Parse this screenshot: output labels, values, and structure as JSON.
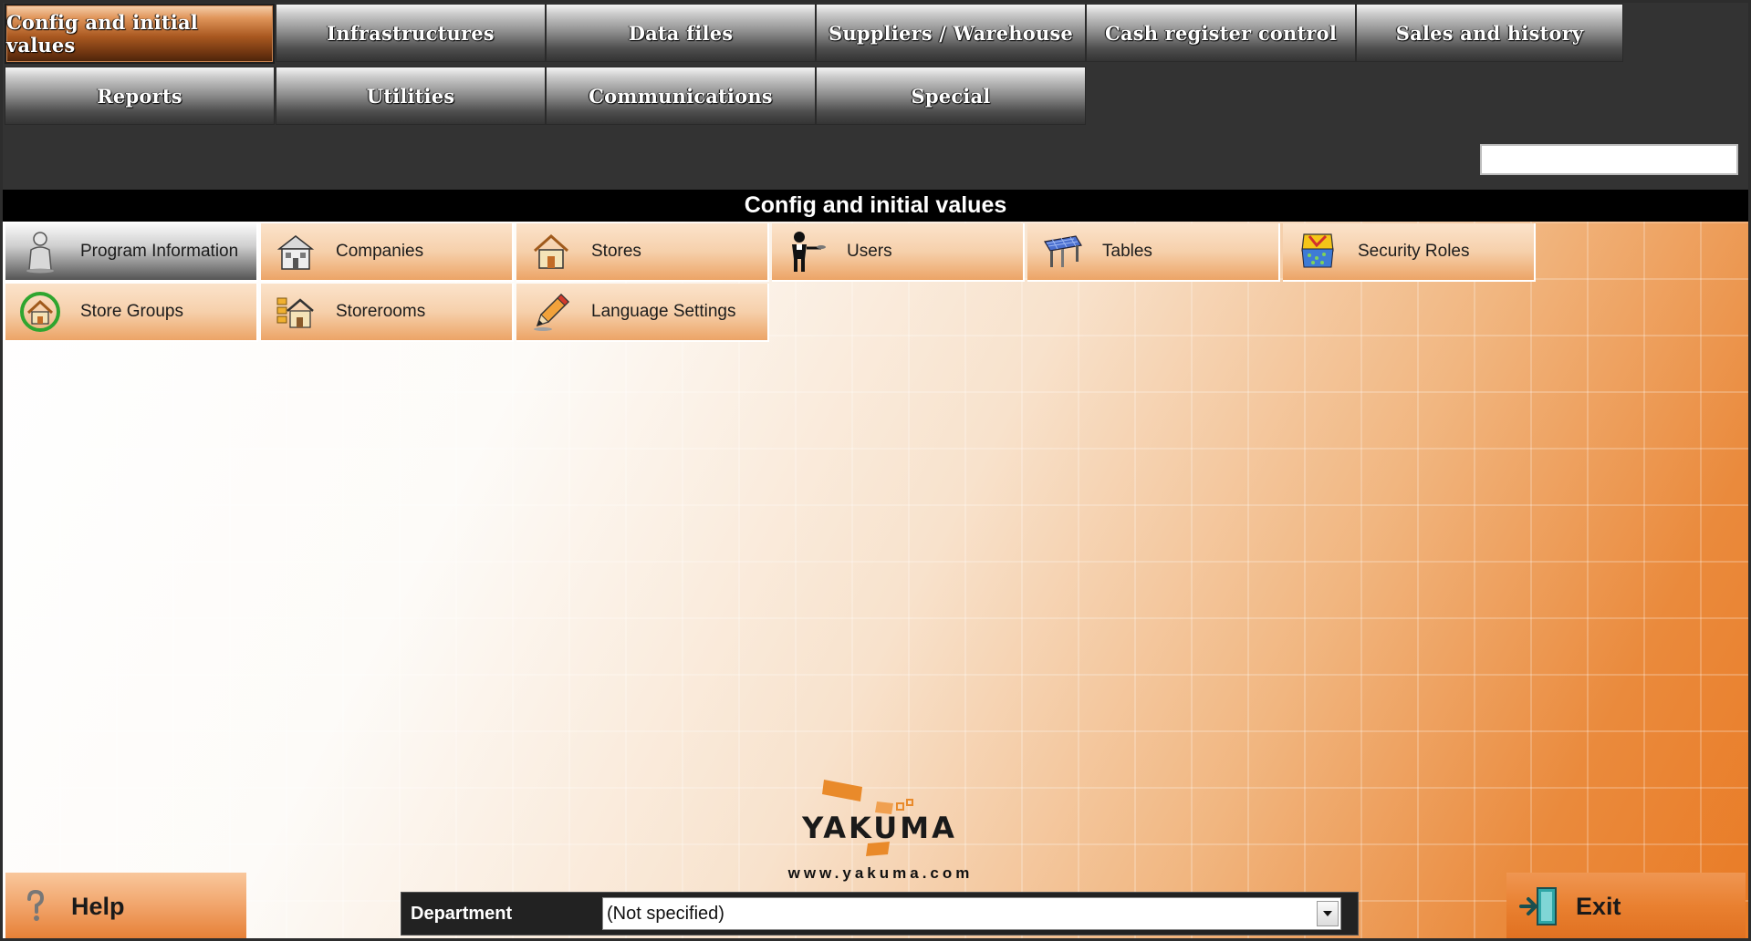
{
  "menu": {
    "row1": [
      {
        "label": "Config and initial values",
        "active": true
      },
      {
        "label": "Infrastructures"
      },
      {
        "label": "Data files"
      },
      {
        "label": "Suppliers / Warehouse"
      },
      {
        "label": "Cash register control"
      },
      {
        "label": "Sales and history"
      }
    ],
    "row2": [
      {
        "label": "Reports"
      },
      {
        "label": "Utilities"
      },
      {
        "label": "Communications"
      },
      {
        "label": "Special"
      }
    ]
  },
  "search": {
    "value": ""
  },
  "section": {
    "title": "Config and initial values"
  },
  "tiles": [
    {
      "label": "Program Information",
      "icon": "person-info-icon",
      "selected": true
    },
    {
      "label": "Companies",
      "icon": "building-icon"
    },
    {
      "label": "Stores",
      "icon": "house-icon"
    },
    {
      "label": "Users",
      "icon": "waiter-icon"
    },
    {
      "label": "Tables",
      "icon": "table-icon"
    },
    {
      "label": "Security Roles",
      "icon": "security-roles-icon"
    },
    {
      "label": "Store Groups",
      "icon": "store-group-icon"
    },
    {
      "label": "Storerooms",
      "icon": "storeroom-icon"
    },
    {
      "label": "Language Settings",
      "icon": "pencil-icon"
    }
  ],
  "logo": {
    "text": "YAKUMA",
    "url": "www.yakuma.com"
  },
  "footer": {
    "help_label": "Help",
    "exit_label": "Exit",
    "department_label": "Department",
    "department_value": "(Not specified)"
  },
  "colors": {
    "accent": "#e97b25",
    "menu_active": "#a95820",
    "section_bar": "#000000"
  }
}
